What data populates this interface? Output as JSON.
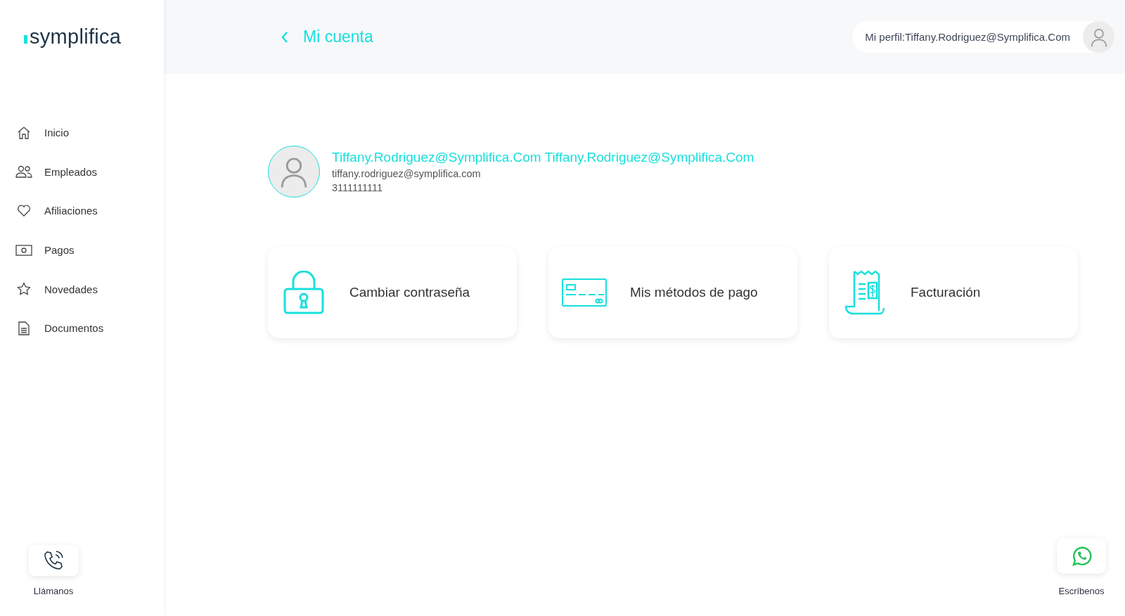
{
  "logo": {
    "text": "symplifica"
  },
  "sidebar": {
    "items": [
      {
        "label": "Inicio",
        "kind": "home"
      },
      {
        "label": "Empleados",
        "kind": "people"
      },
      {
        "label": "Afiliaciones",
        "kind": "heart"
      },
      {
        "label": "Pagos",
        "kind": "money"
      },
      {
        "label": "Novedades",
        "kind": "star"
      },
      {
        "label": "Documentos",
        "kind": "document"
      }
    ],
    "call": {
      "label": "Llámanos"
    }
  },
  "header": {
    "title": "Mi cuenta",
    "profile": "Mi perfil:Tiffany.Rodriguez@Symplifica.Com"
  },
  "user": {
    "name": "Tiffany.Rodriguez@Symplifica.Com Tiffany.Rodriguez@Symplifica.Com",
    "email": "tiffany.rodriguez@symplifica.com",
    "phone": "3111111111"
  },
  "cards": [
    {
      "label": "Cambiar contraseña",
      "kind": "lock"
    },
    {
      "label": "Mis métodos de pago",
      "kind": "card"
    },
    {
      "label": "Facturación",
      "kind": "receipt"
    }
  ],
  "chat": {
    "label": "Escríbenos"
  }
}
